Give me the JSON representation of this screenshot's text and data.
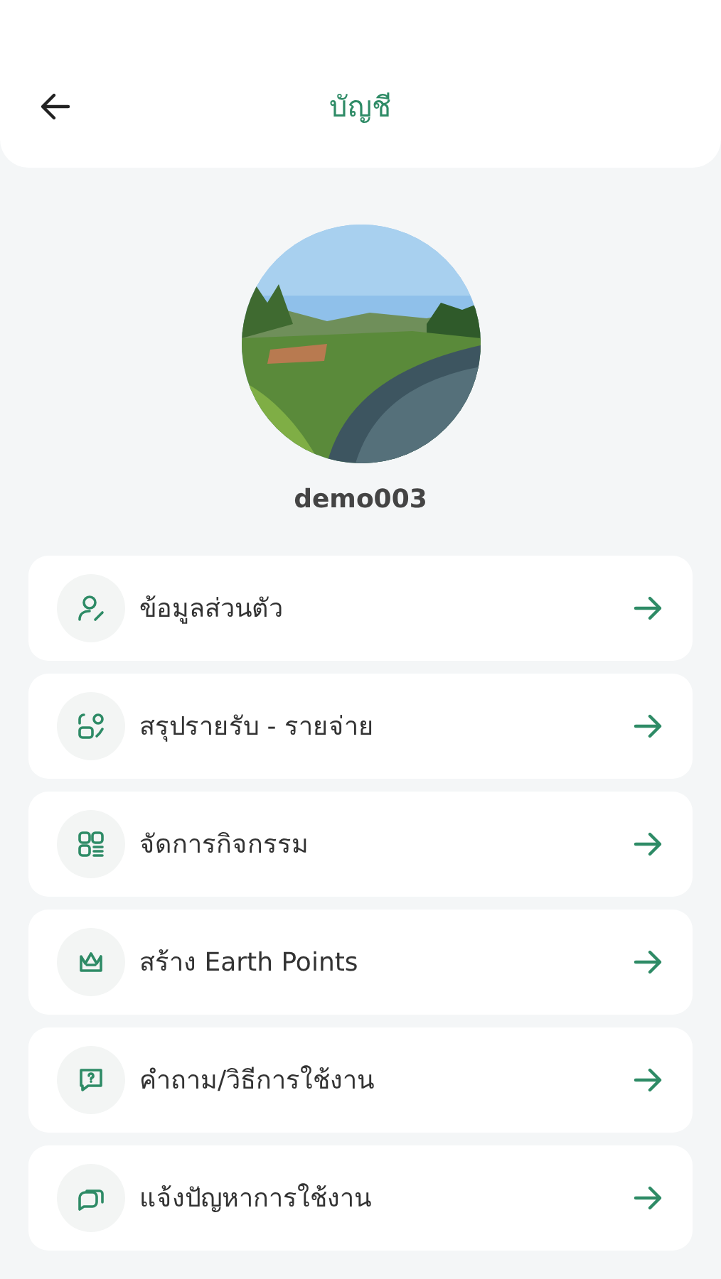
{
  "header": {
    "title": "บัญชี"
  },
  "profile": {
    "username": "demo003"
  },
  "menu": [
    {
      "label": "ข้อมูลส่วนตัว"
    },
    {
      "label": "สรุปรายรับ - รายจ่าย"
    },
    {
      "label": "จัดการกิจกรรม"
    },
    {
      "label": "สร้าง Earth Points"
    },
    {
      "label": "คำถาม/วิธีการใช้งาน"
    },
    {
      "label": "แจ้งปัญหาการใช้งาน"
    }
  ]
}
